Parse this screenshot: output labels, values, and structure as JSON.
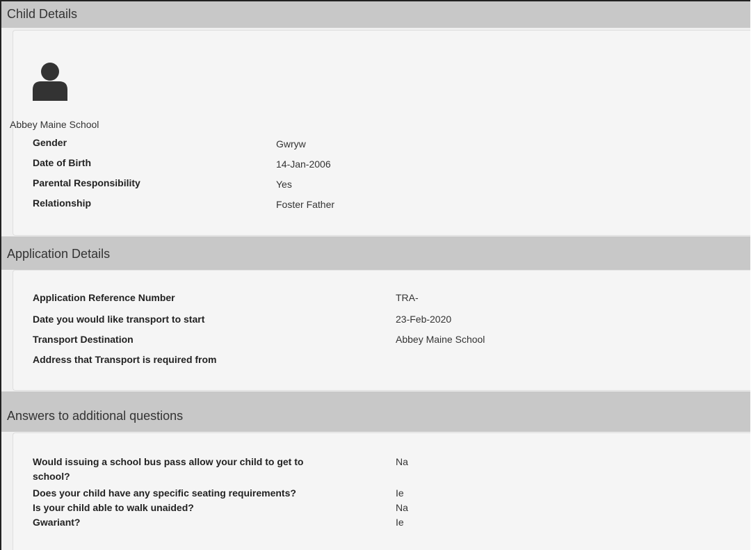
{
  "child_section": {
    "title": "Child Details",
    "school_name": "Abbey Maine School",
    "fields": [
      {
        "label": "Gender",
        "value": "Gwryw"
      },
      {
        "label": "Date of Birth",
        "value": "14-Jan-2006"
      },
      {
        "label": "Parental Responsibility",
        "value": "Yes"
      },
      {
        "label": "Relationship",
        "value": "Foster Father"
      }
    ]
  },
  "application_section": {
    "title": "Application Details",
    "fields": [
      {
        "label": "Application Reference Number",
        "value": "TRA-"
      },
      {
        "label": "Date you would like transport to start",
        "value": "23-Feb-2020"
      },
      {
        "label": "Transport Destination",
        "value": "Abbey Maine School"
      },
      {
        "label": "Address that Transport is required from",
        "value": ""
      }
    ]
  },
  "questions_section": {
    "title": "Answers to additional questions",
    "questions": [
      {
        "label_line1": "Would issuing a school bus pass allow your child to get to",
        "label_line2": "school?",
        "value": "Na"
      },
      {
        "label": "Does your child have any specific seating requirements?",
        "value": "Ie"
      },
      {
        "label": "Is your child able to walk unaided?",
        "value": "Na"
      },
      {
        "label": "Gwariant?",
        "value": "Ie"
      }
    ]
  },
  "icons": {
    "avatar": "user-silhouette-icon"
  },
  "colors": {
    "header_bg": "#c8c8c8",
    "panel_bg": "#f5f5f5",
    "page_bg": "#f0f0f0",
    "icon": "#333333"
  }
}
